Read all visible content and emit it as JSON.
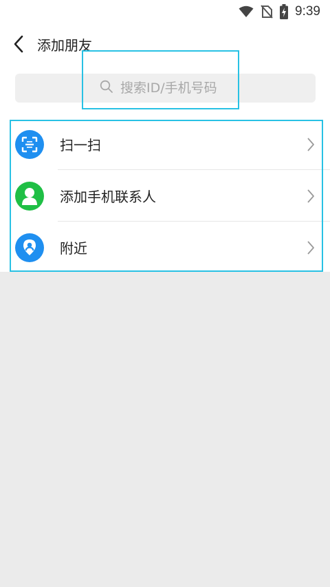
{
  "status_bar": {
    "time": "9:39"
  },
  "header": {
    "title": "添加朋友"
  },
  "search": {
    "placeholder": "搜索ID/手机号码"
  },
  "list": {
    "items": [
      {
        "label": "扫一扫",
        "icon": "scan-icon",
        "color": "#1f8ff0"
      },
      {
        "label": "添加手机联系人",
        "icon": "contact-icon",
        "color": "#1fbf45"
      },
      {
        "label": "附近",
        "icon": "location-icon",
        "color": "#1f8ff0"
      }
    ]
  },
  "colors": {
    "highlight": "#28c1e4",
    "background": "#ebebeb"
  }
}
